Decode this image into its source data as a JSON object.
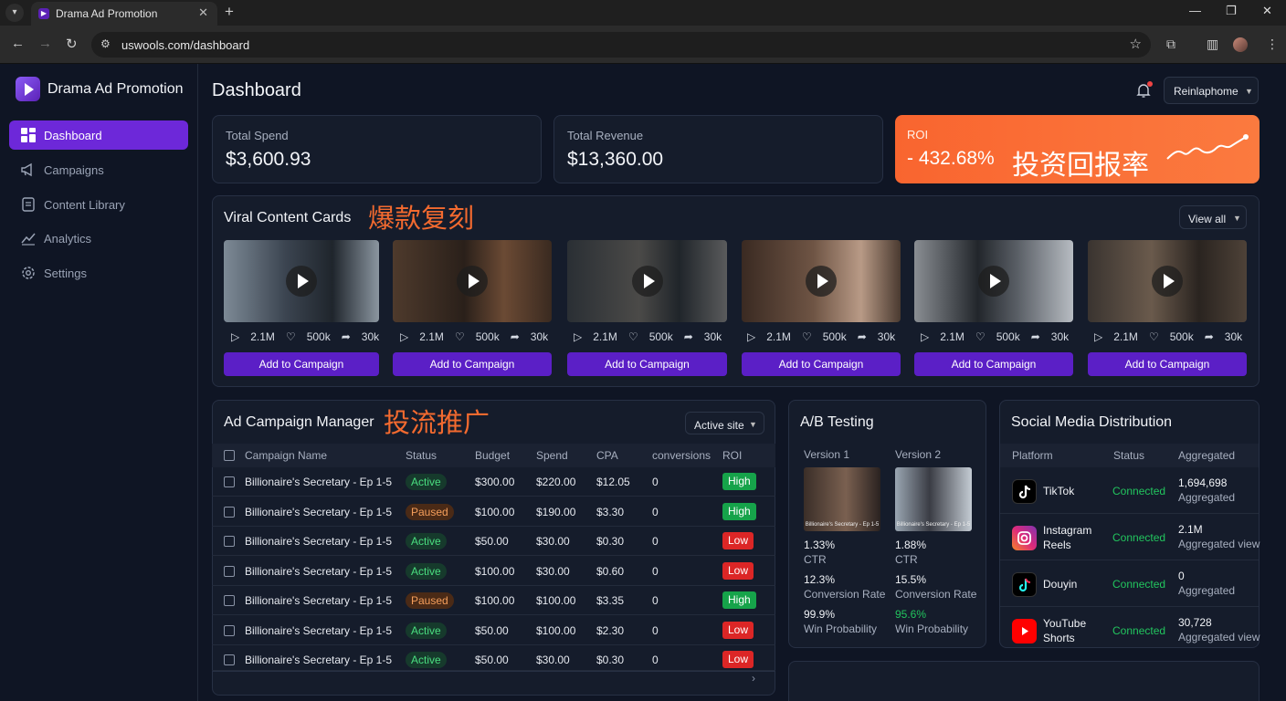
{
  "browser": {
    "tab_title": "Drama Ad Promotion",
    "url": "uswools.com/dashboard"
  },
  "sidebar": {
    "brand": "Drama Ad Promotion",
    "items": [
      {
        "label": "Dashboard",
        "icon": "dashboard-grid-icon",
        "active": true
      },
      {
        "label": "Campaigns",
        "icon": "megaphone-icon"
      },
      {
        "label": "Content Library",
        "icon": "document-icon"
      },
      {
        "label": "Analytics",
        "icon": "chart-line-icon"
      },
      {
        "label": "Settings",
        "icon": "gear-icon"
      }
    ]
  },
  "header": {
    "title": "Dashboard",
    "user": "Reinlaphome"
  },
  "stats": {
    "spend_label": "Total Spend",
    "spend_value": "$3,600.93",
    "revenue_label": "Total Revenue",
    "revenue_value": "$13,360.00",
    "roi_label": "ROI",
    "roi_value": "- 432.68%",
    "roi_annotation": "投资回报率"
  },
  "viral": {
    "title": "Viral Content Cards",
    "annotation": "爆款复刻",
    "view_all": "View all",
    "add_label": "Add to Campaign",
    "cards": [
      {
        "views": "2.1M",
        "likes": "500k",
        "shares": "30k"
      },
      {
        "views": "2.1M",
        "likes": "500k",
        "shares": "30k"
      },
      {
        "views": "2.1M",
        "likes": "500k",
        "shares": "30k"
      },
      {
        "views": "2.1M",
        "likes": "500k",
        "shares": "30k"
      },
      {
        "views": "2.1M",
        "likes": "500k",
        "shares": "30k"
      },
      {
        "views": "2.1M",
        "likes": "500k",
        "shares": "30k"
      }
    ]
  },
  "campaigns": {
    "title": "Ad Campaign Manager",
    "annotation": "投流推广",
    "filter": "Active site",
    "columns": [
      "Campaign Name",
      "Status",
      "Budget",
      "Spend",
      "CPA",
      "conversions",
      "ROI"
    ],
    "rows": [
      {
        "name": "Billionaire's Secretary - Ep 1-5",
        "status": "Active",
        "budget": "$300.00",
        "spend": "$220.00",
        "cpa": "$12.05",
        "conv": "0",
        "roi": "High"
      },
      {
        "name": "Billionaire's Secretary - Ep 1-5",
        "status": "Paused",
        "budget": "$100.00",
        "spend": "$190.00",
        "cpa": "$3.30",
        "conv": "0",
        "roi": "High"
      },
      {
        "name": "Billionaire's Secretary - Ep 1-5",
        "status": "Active",
        "budget": "$50.00",
        "spend": "$30.00",
        "cpa": "$0.30",
        "conv": "0",
        "roi": "Low"
      },
      {
        "name": "Billionaire's Secretary - Ep 1-5",
        "status": "Active",
        "budget": "$100.00",
        "spend": "$30.00",
        "cpa": "$0.60",
        "conv": "0",
        "roi": "Low"
      },
      {
        "name": "Billionaire's Secretary - Ep 1-5",
        "status": "Paused",
        "budget": "$100.00",
        "spend": "$100.00",
        "cpa": "$3.35",
        "conv": "0",
        "roi": "High"
      },
      {
        "name": "Billionaire's Secretary - Ep 1-5",
        "status": "Active",
        "budget": "$50.00",
        "spend": "$100.00",
        "cpa": "$2.30",
        "conv": "0",
        "roi": "Low"
      },
      {
        "name": "Billionaire's Secretary - Ep 1-5",
        "status": "Active",
        "budget": "$50.00",
        "spend": "$30.00",
        "cpa": "$0.30",
        "conv": "0",
        "roi": "Low"
      }
    ]
  },
  "ab": {
    "title": "A/B Testing",
    "v1": {
      "label": "Version 1",
      "caption": "Billionaire's Secretary - Ep 1-5",
      "ctr": "1.33%",
      "ctr_label": "CTR",
      "conv": "12.3%",
      "conv_label": "Conversion Rate",
      "win": "99.9%",
      "win_label": "Win Probability"
    },
    "v2": {
      "label": "Version 2",
      "caption": "Billionaire's Secretary - Ep 1-5",
      "ctr": "1.88%",
      "ctr_label": "CTR",
      "conv": "15.5%",
      "conv_label": "Conversion Rate",
      "win": "95.6%",
      "win_label": "Win Probability"
    }
  },
  "social": {
    "title": "Social Media Distribution",
    "columns": [
      "Platform",
      "Status",
      "Aggregated"
    ],
    "rows": [
      {
        "name": "TikTok",
        "status": "Connected",
        "value": "1,694,698",
        "sub": "Aggregated",
        "icon": "tiktok-icon"
      },
      {
        "name": "Instagram Reels",
        "status": "Connected",
        "value": "2.1M",
        "sub": "Aggregated view",
        "icon": "instagram-icon"
      },
      {
        "name": "Douyin",
        "status": "Connected",
        "value": "0",
        "sub": "Aggregated",
        "icon": "douyin-icon"
      },
      {
        "name": "YouTube Shorts",
        "status": "Connected",
        "value": "30,728",
        "sub": "Aggregated view",
        "icon": "youtube-shorts-icon"
      }
    ]
  }
}
